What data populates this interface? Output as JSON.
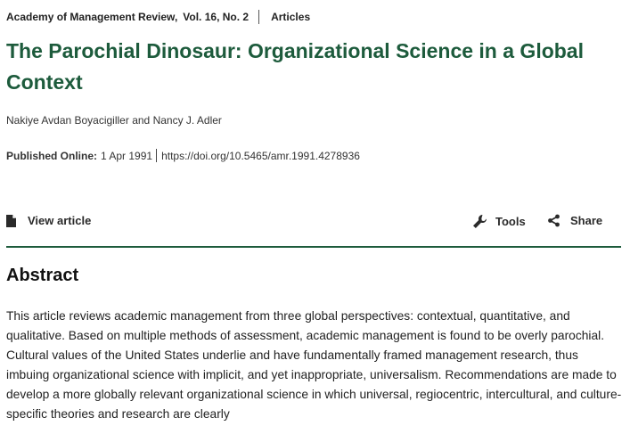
{
  "breadcrumb": {
    "journal": "Academy of Management Review,",
    "volume": "Vol. 16, No. 2",
    "section": "Articles"
  },
  "article": {
    "title": "The Parochial Dinosaur: Organizational Science in a Global Context",
    "author1": "Nakiye Avdan Boyacigiller",
    "author_sep": "and",
    "author2": "Nancy J. Adler",
    "published_label": "Published Online:",
    "published_date": "1 Apr 1991",
    "doi": "https://doi.org/10.5465/amr.1991.4278936"
  },
  "toolbar": {
    "view_label": "View article",
    "view_icon": "document-icon",
    "tools_label": "Tools",
    "tools_icon": "wrench-icon",
    "share_label": "Share",
    "share_icon": "share-icon"
  },
  "abstract": {
    "heading": "Abstract",
    "text": "This article reviews academic management from three global perspectives: contextual, quantitative, and qualitative. Based on multiple methods of assessment, academic management is found to be overly parochial. Cultural values of the United States underlie and have fundamentally framed management research, thus imbuing organizational science with implicit, and yet inappropriate, universalism. Recommendations are made to develop a more globally relevant organizational science in which universal, regiocentric, intercultural, and culture-specific theories and research are clearly"
  },
  "colors": {
    "accent": "#1d5b3c",
    "text": "#222222"
  }
}
